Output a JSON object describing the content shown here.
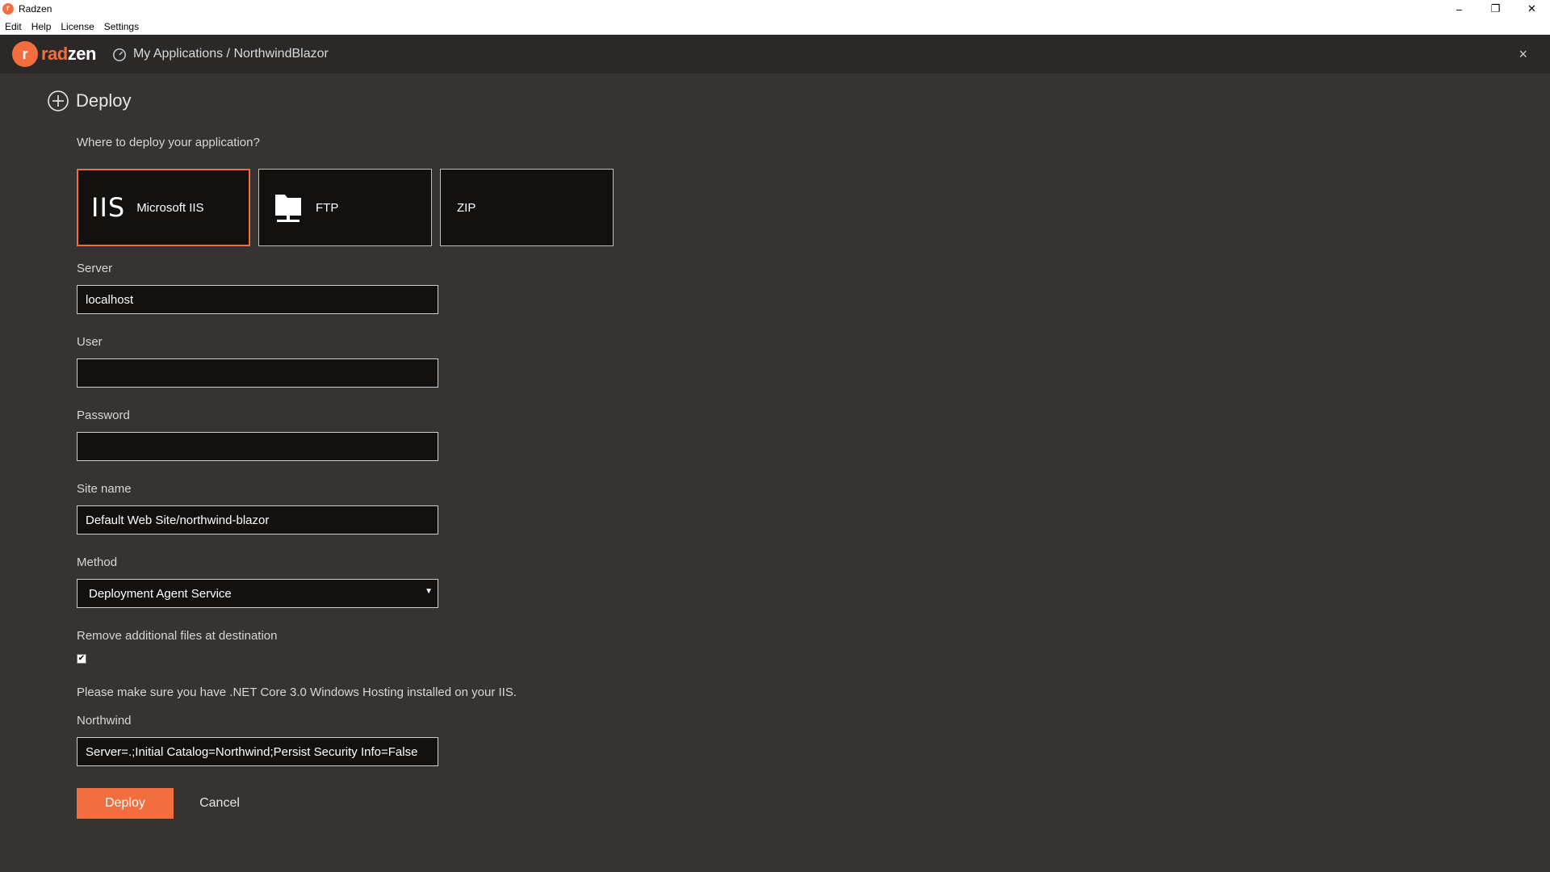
{
  "window": {
    "title": "Radzen",
    "controls": {
      "minimize": "–",
      "restore": "❐",
      "close": "✕"
    }
  },
  "menubar": {
    "items": [
      "Edit",
      "Help",
      "License",
      "Settings"
    ]
  },
  "header": {
    "logo_prefix": "rad",
    "logo_suffix": "zen",
    "breadcrumb": "My Applications / NorthwindBlazor",
    "close": "×"
  },
  "page": {
    "title": "Deploy",
    "question": "Where to deploy your application?",
    "targets": [
      {
        "label": "Microsoft IIS",
        "glyph": "IIS",
        "selected": true
      },
      {
        "label": "FTP",
        "selected": false
      },
      {
        "label": "ZIP",
        "selected": false
      }
    ]
  },
  "form": {
    "server": {
      "label": "Server",
      "value": "localhost"
    },
    "user": {
      "label": "User",
      "value": ""
    },
    "password": {
      "label": "Password",
      "value": ""
    },
    "site_name": {
      "label": "Site name",
      "value": "Default Web Site/northwind-blazor"
    },
    "method": {
      "label": "Method",
      "value": "Deployment Agent Service"
    },
    "remove_files": {
      "label": "Remove additional files at destination",
      "checked": true
    },
    "note": "Please make sure you have .NET Core 3.0 Windows Hosting installed on your IIS.",
    "northwind": {
      "label": "Northwind",
      "value": "Server=.;Initial Catalog=Northwind;Persist Security Info=False"
    }
  },
  "actions": {
    "deploy": "Deploy",
    "cancel": "Cancel"
  },
  "colors": {
    "accent": "#f36e3f",
    "background": "#373331",
    "header": "#2b2928"
  }
}
